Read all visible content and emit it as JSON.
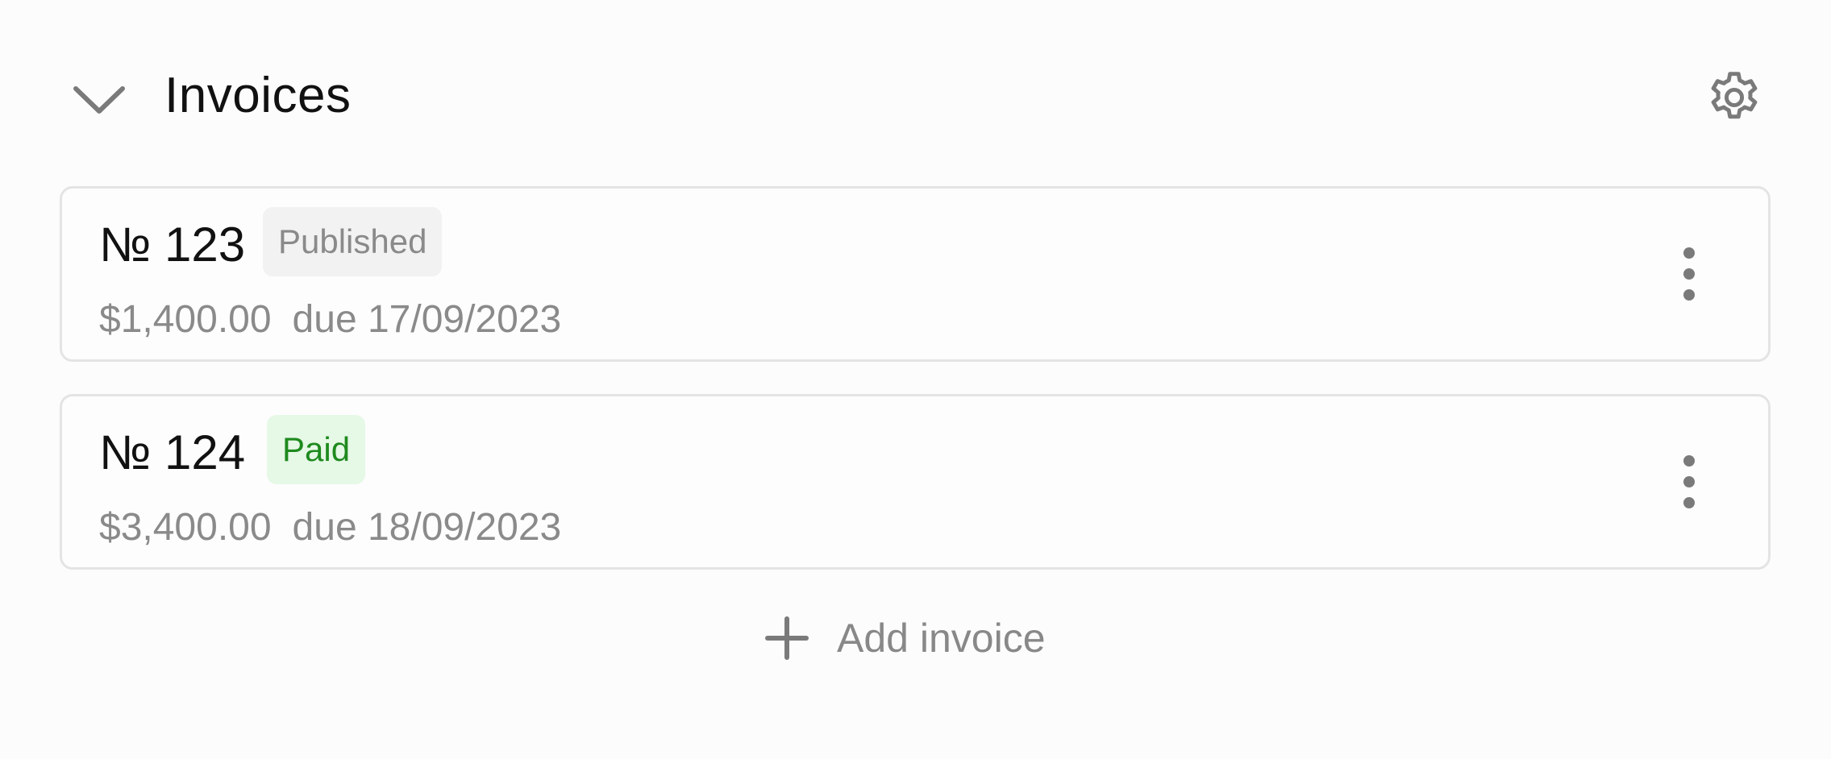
{
  "header": {
    "title": "Invoices",
    "collapse_icon": "chevron-down-icon",
    "settings_icon": "gear-icon"
  },
  "invoices": [
    {
      "number": "№ 123",
      "status": "Published",
      "amount": "$1,400.00",
      "due": "due 17/09/2023",
      "menu_icon": "more-vertical-icon"
    },
    {
      "number": "№ 124",
      "status": "Paid",
      "amount": "$3,400.00",
      "due": "due 18/09/2023",
      "menu_icon": "more-vertical-icon"
    }
  ],
  "add_button": {
    "label": "Add invoice",
    "icon": "plus-icon"
  },
  "colors": {
    "published_bg": "#f2f2f2",
    "published_text": "#8a8a8a",
    "paid_bg": "#e6f8e6",
    "paid_text": "#1e8a1e",
    "muted_text": "#8a8a8a",
    "icon_gray": "#7a7a7a"
  }
}
